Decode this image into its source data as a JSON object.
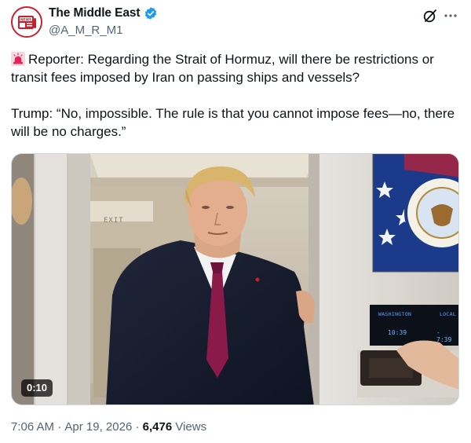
{
  "author": {
    "display_name": "The Middle East",
    "handle": "@A_M_R_M1",
    "avatar_label": "NEWS",
    "verified_color": "#1d9bf0"
  },
  "tweet": {
    "paragraph1": "Reporter: Regarding the Strait of Hormuz, will there be restrictions or transit fees imposed by Iran on passing ships and vessels?",
    "paragraph2": "Trump: “No, impossible. The rule is that you cannot impose fees—no, there will be no charges.”",
    "leading_icon": "siren-emoji"
  },
  "media": {
    "duration": "0:10",
    "exit_sign": "EXIT",
    "clock": {
      "left_label": "WASHINGTON",
      "right_label": "LOCAL",
      "left_time": "10:39",
      "right_time": "- 7:39"
    }
  },
  "footer": {
    "time": "7:06 AM",
    "separator1": " · ",
    "date": "Apr 19, 2026",
    "separator2": " · ",
    "views_count": "6,476",
    "views_label": " Views"
  },
  "icons": {
    "grok": "grok-icon",
    "more": "more-icon"
  }
}
